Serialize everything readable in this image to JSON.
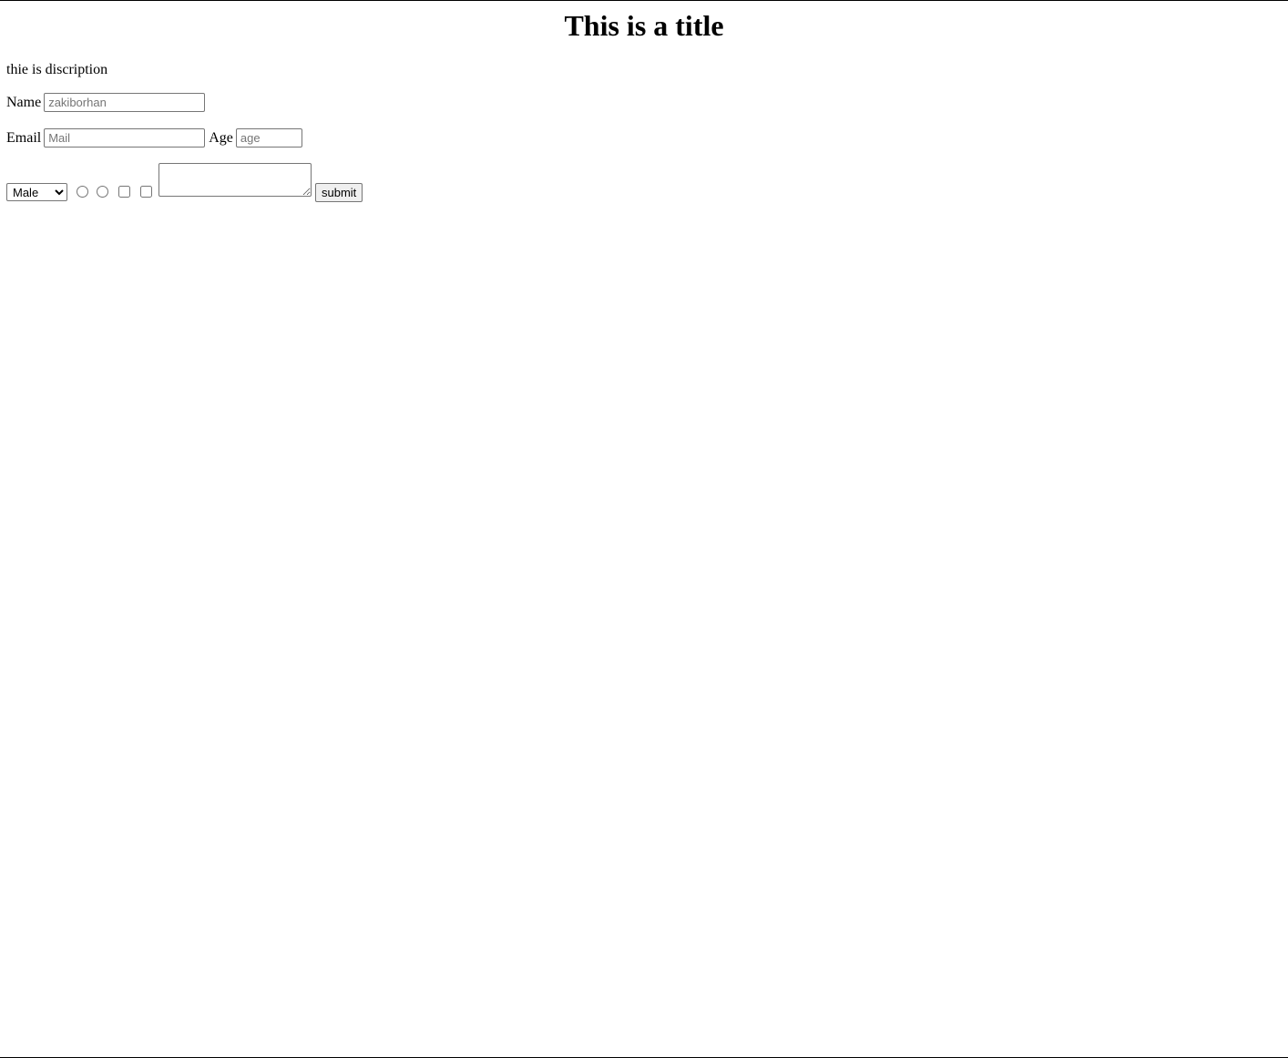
{
  "page": {
    "title": "This is a title",
    "description": "thie is discription"
  },
  "form": {
    "name_label": "Name",
    "name_placeholder": "zakiborhan",
    "email_label": "Email",
    "email_placeholder": "Mail",
    "age_label": "Age",
    "age_placeholder": "age",
    "gender_select": {
      "selected": "Male",
      "options": [
        "Male"
      ]
    },
    "radios": [
      {
        "checked": false
      },
      {
        "checked": false
      }
    ],
    "checkboxes": [
      {
        "checked": false
      },
      {
        "checked": false
      }
    ],
    "textarea_value": "",
    "submit_label": "submit"
  }
}
